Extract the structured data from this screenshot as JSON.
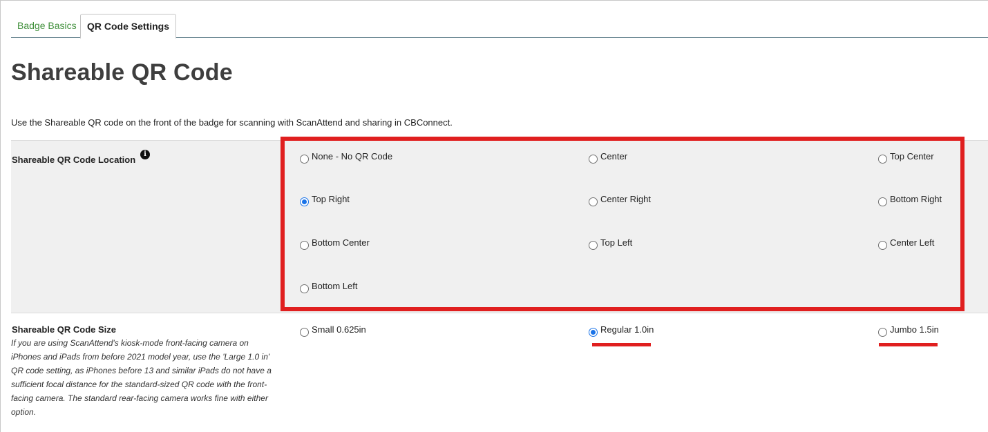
{
  "tabs": [
    {
      "label": "Badge Basics",
      "active": false
    },
    {
      "label": "QR Code Settings",
      "active": true
    }
  ],
  "page": {
    "title": "Shareable QR Code",
    "description": "Use the Shareable QR code on the front of the badge for scanning with ScanAttend and sharing in CBConnect."
  },
  "location": {
    "label": "Shareable QR Code Location",
    "info_icon": "info-icon",
    "selected": "Top Right",
    "options": [
      "None - No QR Code",
      "Center",
      "Top Center",
      "Top Right",
      "Center Right",
      "Bottom Right",
      "Bottom Center",
      "Top Left",
      "Center Left",
      "Bottom Left"
    ]
  },
  "size": {
    "label": "Shareable QR Code Size",
    "help": "If you are using ScanAttend's kiosk-mode front-facing camera on iPhones and iPads from before 2021 model year, use the 'Large 1.0 in' QR code setting, as iPhones before 13 and similar iPads do not have a sufficient focal distance for the standard-sized QR code with the front-facing camera. The standard rear-facing camera works fine with either option.",
    "selected": "Regular 1.0in",
    "options": [
      "Small 0.625in",
      "Regular 1.0in",
      "Jumbo 1.5in"
    ]
  },
  "annotation_color": "#e01f1f",
  "accent_color": "#1a73e8"
}
